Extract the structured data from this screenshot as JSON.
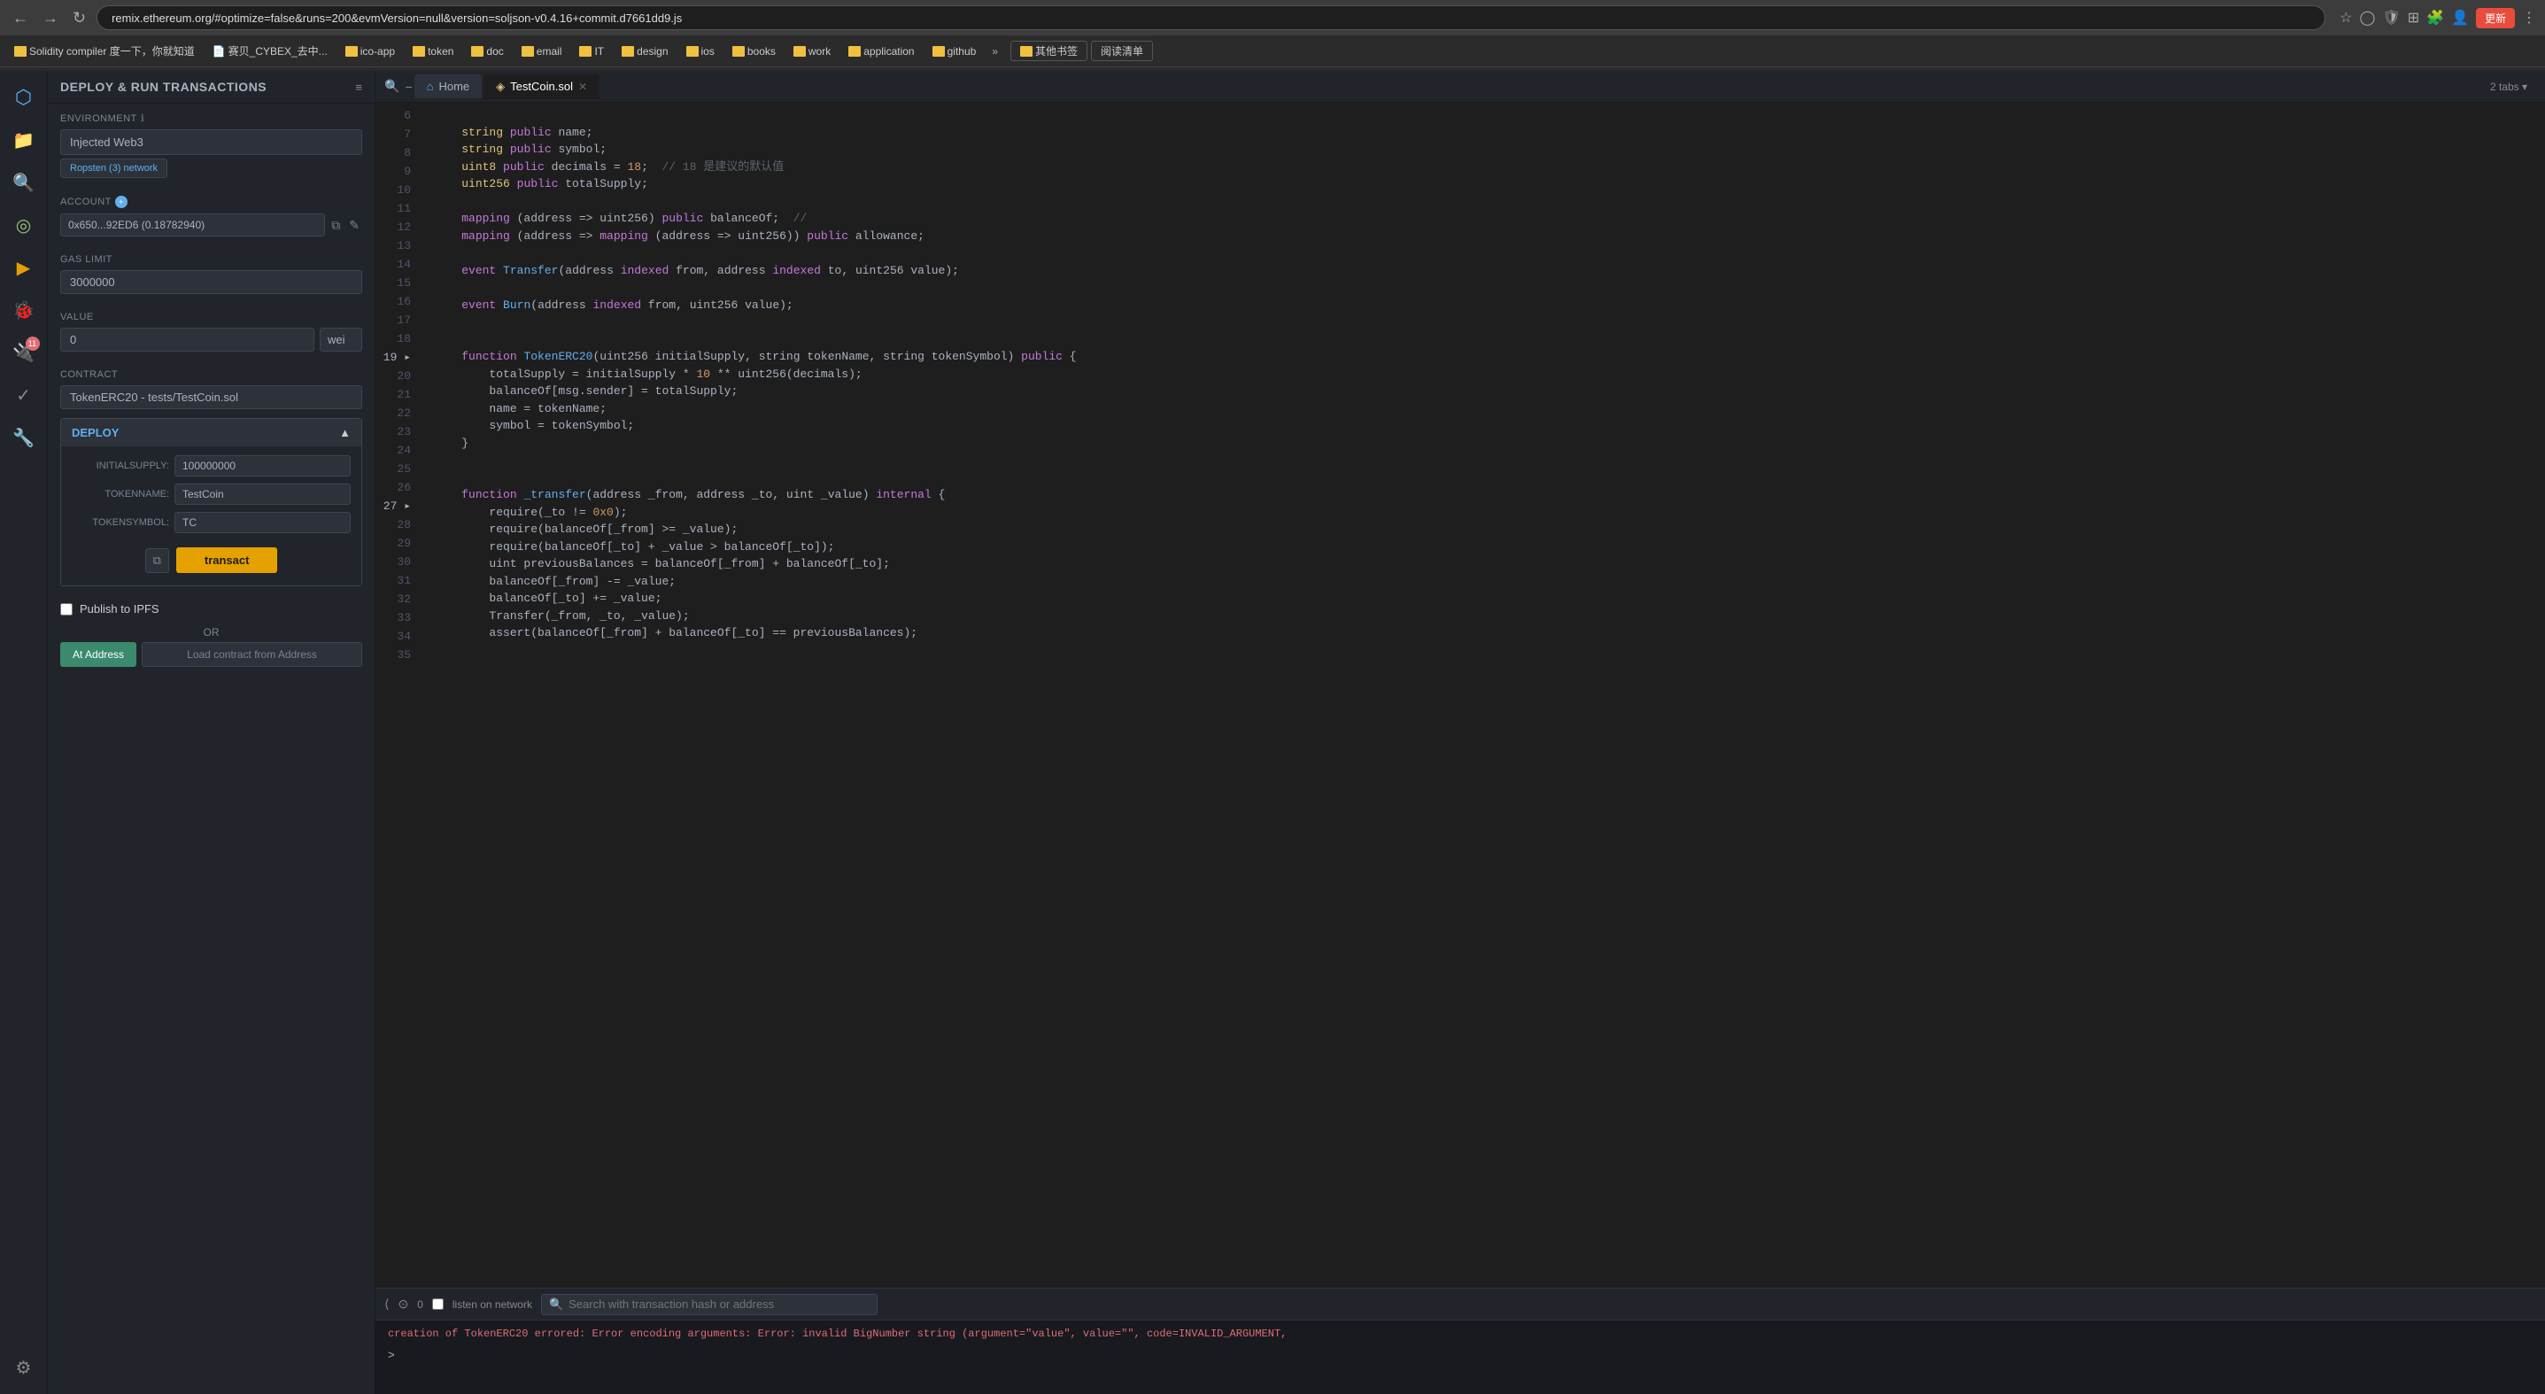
{
  "browser": {
    "url": "remix.ethereum.org/#optimize=false&runs=200&evmVersion=null&version=soljson-v0.4.16+commit.d7661dd9.js",
    "back_btn": "←",
    "forward_btn": "→",
    "refresh_btn": "↻",
    "update_btn": "更新",
    "tabs_count": "2 tabs ▾",
    "bookmarks": [
      {
        "id": "solidity-compiler",
        "label": "Solidity compiler 度一下，你就知道"
      },
      {
        "id": "cybex",
        "label": "赛贝_CYBEX_去中..."
      },
      {
        "id": "ico-app",
        "label": "ico-app"
      },
      {
        "id": "token",
        "label": "token"
      },
      {
        "id": "doc",
        "label": "doc"
      },
      {
        "id": "email",
        "label": "email"
      },
      {
        "id": "IT",
        "label": "IT"
      },
      {
        "id": "design",
        "label": "design"
      },
      {
        "id": "ios",
        "label": "ios"
      },
      {
        "id": "books",
        "label": "books"
      },
      {
        "id": "work",
        "label": "work"
      },
      {
        "id": "application",
        "label": "application"
      },
      {
        "id": "github",
        "label": "github"
      },
      {
        "id": "more",
        "label": "»"
      },
      {
        "id": "other-books",
        "label": "其他书签"
      },
      {
        "id": "reading-list",
        "label": "阅读清单"
      }
    ]
  },
  "sidebar_icons": [
    {
      "id": "plugin",
      "icon": "⬡",
      "active": true
    },
    {
      "id": "files",
      "icon": "📄",
      "active": false
    },
    {
      "id": "search",
      "icon": "🔍",
      "active": false
    },
    {
      "id": "git",
      "icon": "◎",
      "active": false,
      "active_green": true
    },
    {
      "id": "deploy",
      "icon": "▶",
      "active": false
    },
    {
      "id": "debug",
      "icon": "🐞",
      "active": false
    },
    {
      "id": "plugins",
      "icon": "🔌",
      "active": false,
      "badge": "11"
    },
    {
      "id": "test",
      "icon": "✓",
      "active": false
    },
    {
      "id": "tools",
      "icon": "🔧",
      "active": false
    },
    {
      "id": "settings",
      "icon": "⚙",
      "active": false
    }
  ],
  "panel": {
    "title": "DEPLOY & RUN TRANSACTIONS",
    "menu_icon": "≡",
    "environment_label": "ENVIRONMENT",
    "environment_value": "Injected Web3",
    "network_badge": "Ropsten (3) network",
    "account_label": "ACCOUNT",
    "account_value": "0x650...92ED6 (0.18782940)",
    "gas_limit_label": "GAS LIMIT",
    "gas_limit_value": "3000000",
    "value_label": "VALUE",
    "value_amount": "0",
    "value_unit": "wei",
    "contract_label": "CONTRACT",
    "contract_value": "TokenERC20 - tests/TestCoin.sol",
    "deploy_title": "DEPLOY",
    "deploy_collapse": "▲",
    "params": [
      {
        "id": "initialsupply",
        "label": "INITIALSUPPLY:",
        "value": "100000000"
      },
      {
        "id": "tokenname",
        "label": "TOKENNAME:",
        "value": "TestCoin"
      },
      {
        "id": "tokensymbol",
        "label": "TOKENSYMBOL:",
        "value": "TC"
      }
    ],
    "transact_btn": "transact",
    "copy_btn": "⧉",
    "publish_ipfs_label": "Publish to IPFS",
    "or_label": "OR",
    "at_address_btn": "At Address",
    "load_contract_btn": "Load contract from Address"
  },
  "editor": {
    "home_tab": "Home",
    "file_tab": "TestCoin.sol",
    "code_lines": [
      {
        "num": 6,
        "content": "    string <k>public</k> name;"
      },
      {
        "num": 7,
        "content": "    string <k>public</k> symbol;"
      },
      {
        "num": 8,
        "content": "    uint8 <k>public</k> decimals = 18;  <c>// 18 是建议的默认值</c>"
      },
      {
        "num": 9,
        "content": "    uint256 <k>public</k> totalSupply;"
      },
      {
        "num": 10,
        "content": ""
      },
      {
        "num": 11,
        "content": "    mapping (address => uint256) <k>public</k> balanceOf;  <c>//</c>"
      },
      {
        "num": 12,
        "content": "    mapping (address => mapping (address => uint256)) <k>public</k> allowance;"
      },
      {
        "num": 13,
        "content": ""
      },
      {
        "num": 14,
        "content": "    event Transfer(address <k>indexed</k> from, address <k>indexed</k> to, uint256 value);"
      },
      {
        "num": 15,
        "content": ""
      },
      {
        "num": 16,
        "content": "    event Burn(address <k>indexed</k> from, uint256 value);"
      },
      {
        "num": 17,
        "content": ""
      },
      {
        "num": 18,
        "content": ""
      },
      {
        "num": 19,
        "content": "    function TokenERC20(uint256 initialSupply, string tokenName, string tokenSymbol) <k>public</k> {"
      },
      {
        "num": 20,
        "content": "        totalSupply = initialSupply * 10 ** uint256(decimals);"
      },
      {
        "num": 21,
        "content": "        balanceOf[msg.sender] = totalSupply;"
      },
      {
        "num": 22,
        "content": "        name = tokenName;"
      },
      {
        "num": 23,
        "content": "        symbol = tokenSymbol;"
      },
      {
        "num": 24,
        "content": "    }"
      },
      {
        "num": 25,
        "content": ""
      },
      {
        "num": 26,
        "content": ""
      },
      {
        "num": 27,
        "content": "    function _transfer(address _from, address _to, uint _value) <k>internal</k> {"
      },
      {
        "num": 28,
        "content": "        require(_to != 0x0);"
      },
      {
        "num": 29,
        "content": "        require(balanceOf[_from] >= _value);"
      },
      {
        "num": 30,
        "content": "        require(balanceOf[_to] + _value > balanceOf[_to]);"
      },
      {
        "num": 31,
        "content": "        uint previousBalances = balanceOf[_from] + balanceOf[_to];"
      },
      {
        "num": 32,
        "content": "        balanceOf[_from] -= _value;"
      },
      {
        "num": 33,
        "content": "        balanceOf[_to] += _value;"
      },
      {
        "num": 34,
        "content": "        Transfer(_from, _to, _value);"
      },
      {
        "num": 35,
        "content": "        assert(balanceOf[_from] + balanceOf[_to] == previousBalances);"
      }
    ]
  },
  "terminal": {
    "collapse_btn": "⟨",
    "history_btn": "⊙",
    "tx_count": "0",
    "listen_label": "listen on network",
    "search_placeholder": "Search with transaction hash or address",
    "error_msg": "creation of TokenERC20 errored: Error encoding arguments: Error: invalid BigNumber string (argument=\"value\", value=\"\", code=INVALID_ARGUMENT,",
    "prompt": ">"
  }
}
